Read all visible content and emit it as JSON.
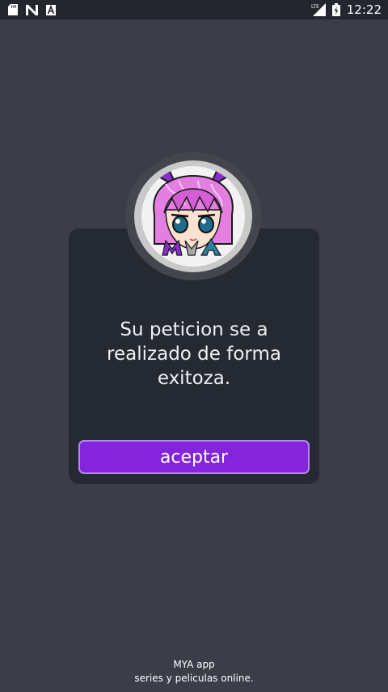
{
  "status_bar": {
    "time": "12:22",
    "network": "LTE",
    "left_icons": [
      "sd-card-icon",
      "n-notification-icon",
      "a-notification-icon"
    ],
    "right_icons": [
      "signal-lte-icon",
      "battery-charging-icon"
    ]
  },
  "dialog": {
    "logo_text": "MYA",
    "message": "Su peticion se a realizado de forma exitoza.",
    "accept_label": "aceptar"
  },
  "footer": {
    "app_name": "MYA app",
    "tagline": "series y peliculas online."
  },
  "colors": {
    "background": "#3b3e48",
    "dialog": "#252a32",
    "accent": "#8424dd",
    "status_bar": "#23262d"
  }
}
